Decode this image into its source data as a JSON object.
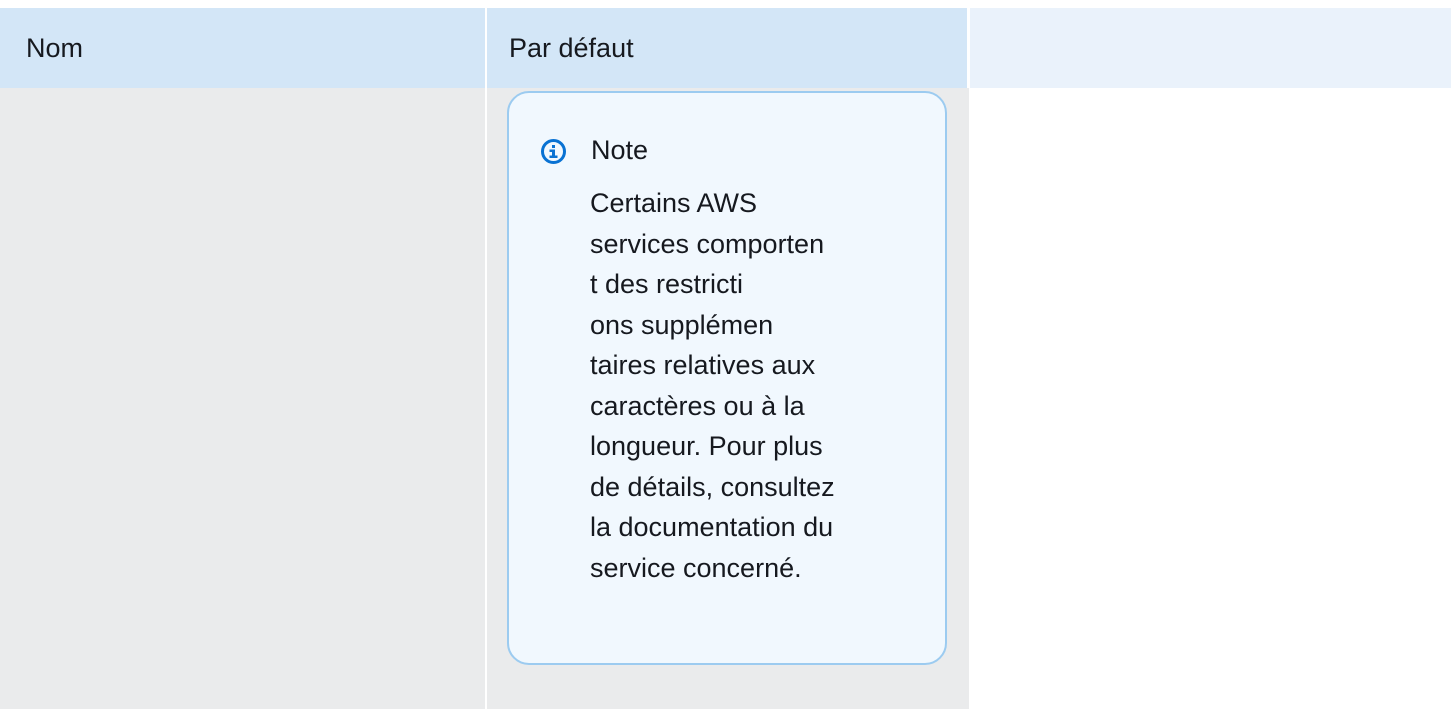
{
  "table": {
    "columns": [
      "Nom",
      "Par défaut",
      ""
    ],
    "rows": [
      {
        "name": "",
        "default": {
          "note": {
            "title": "Note",
            "icon": "info-icon",
            "lines": [
              "Certains AWS",
              "services comporten",
              "t des restricti",
              "ons supplémen",
              "taires relatives aux",
              "caractères ou à la",
              "longueur. Pour plus",
              "de détails, consultez",
              "la documentation du",
              "service concerné."
            ]
          }
        }
      }
    ]
  },
  "colors": {
    "header_bg": "#d3e6f7",
    "header_empty_bg": "#eaf2fb",
    "cell_bg": "#eaebec",
    "note_bg": "#f1f8fe",
    "note_border": "#9ccbf0",
    "info_icon": "#0972d3"
  }
}
